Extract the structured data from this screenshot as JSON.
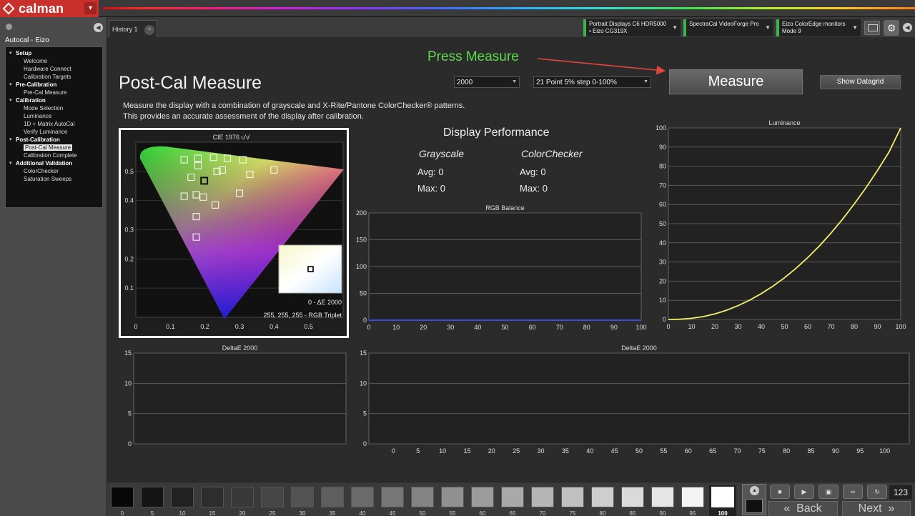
{
  "app": {
    "logo": "calman"
  },
  "colors": {
    "accent_red": "#c9302c",
    "green_status": "#3fb24a",
    "press_measure": "#5ddc4a",
    "curve_yellow": "#f4ee6a",
    "rgb_line": "#3a50ff"
  },
  "sidebar": {
    "title": "Autocal - Eizo",
    "sections": [
      {
        "label": "Setup",
        "items": [
          "Welcome",
          "Hardware Connect",
          "Calibration Targets"
        ]
      },
      {
        "label": "Pre-Calibration",
        "items": [
          "Pre-Cal Measure"
        ]
      },
      {
        "label": "Calibration",
        "items": [
          "Mode Selection",
          "Luminance",
          "1D + Matrix AutoCal",
          "Verify Luminance"
        ]
      },
      {
        "label": "Post-Calibration",
        "items": [
          "Post-Cal Measure",
          "Calibration Complete"
        ]
      },
      {
        "label": "Additional Validation",
        "items": [
          "ColorChecker",
          "Saturation Sweeps"
        ]
      }
    ],
    "active_item": "Post-Cal Measure"
  },
  "tabs": {
    "history": "History 1",
    "add": "+"
  },
  "devices": [
    {
      "line1": "Portrait Displays C6 HDR5000",
      "line2": "• Eizo CG319X"
    },
    {
      "line1": "SpectraCal VideoForge Pro",
      "line2": ""
    },
    {
      "line1": "Eizo ColorEdge monitors",
      "line2": "Mode 9"
    }
  ],
  "annotation": {
    "press_measure": "Press Measure"
  },
  "page": {
    "title": "Post-Cal Measure",
    "desc1": "Measure the display with a combination of grayscale and X-Rite/Pantone ColorChecker® patterns.",
    "desc2": "This provides an accurate assessment of the display after calibration."
  },
  "controls": {
    "de_select": "2000",
    "point_select": "21 Point 5% step 0-100%",
    "measure": "Measure",
    "show_datagrid": "Show Datagrid"
  },
  "performance": {
    "title": "Display Performance",
    "grayscale": {
      "label": "Grayscale",
      "avg": "Avg: 0",
      "max": "Max: 0"
    },
    "colorchecker": {
      "label": "ColorChecker",
      "avg": "Avg: 0",
      "max": "Max: 0"
    }
  },
  "cie": {
    "title": "CIE 1976 u'v'",
    "de_label": "0 - ΔE 2000",
    "triplet_label": "255, 255, 255 - RGB Triplet",
    "x_ticks": [
      "0",
      "0.1",
      "0.2",
      "0.3",
      "0.4",
      "0.5"
    ],
    "y_ticks": [
      "0.1",
      "0.2",
      "0.3",
      "0.4",
      "0.5"
    ]
  },
  "chart_data": [
    {
      "type": "line",
      "title": "Luminance",
      "xlabel": "",
      "ylabel": "",
      "xlim": [
        0,
        100
      ],
      "ylim": [
        0,
        100
      ],
      "x_ticks": [
        "0",
        "10",
        "20",
        "30",
        "40",
        "50",
        "60",
        "70",
        "80",
        "90",
        "100"
      ],
      "y_ticks": [
        "0",
        "10",
        "20",
        "30",
        "40",
        "50",
        "60",
        "70",
        "80",
        "90",
        "100"
      ],
      "x": [
        0,
        5,
        10,
        15,
        20,
        25,
        30,
        35,
        40,
        45,
        50,
        55,
        60,
        65,
        70,
        75,
        80,
        85,
        90,
        95,
        100
      ],
      "series": [
        {
          "values": [
            0,
            0.1,
            0.6,
            1.5,
            2.9,
            4.8,
            7.2,
            10.1,
            13.5,
            17.4,
            21.8,
            26.8,
            32.3,
            38.4,
            45.1,
            52.4,
            60.3,
            68.7,
            77.8,
            87.5,
            100
          ]
        }
      ],
      "grid": true
    },
    {
      "type": "line",
      "title": "RGB Balance",
      "xlabel": "",
      "ylabel": "",
      "xlim": [
        0,
        100
      ],
      "ylim": [
        0,
        200
      ],
      "x_ticks": [
        "0",
        "10",
        "20",
        "30",
        "40",
        "50",
        "60",
        "70",
        "80",
        "90",
        "100"
      ],
      "y_ticks": [
        "0",
        "50",
        "100",
        "150",
        "200"
      ],
      "x": [
        0,
        100
      ],
      "series": [
        {
          "values": [
            0,
            0
          ]
        }
      ],
      "grid": true
    },
    {
      "type": "bar",
      "title": "DeltaE 2000",
      "ylim": [
        0,
        15
      ],
      "y_ticks": [
        "0",
        "5",
        "10",
        "15"
      ],
      "categories": [],
      "values": [],
      "grid": true
    },
    {
      "type": "bar",
      "title": "DeltaE 2000",
      "ylim": [
        0,
        15
      ],
      "y_ticks": [
        "0",
        "5",
        "10",
        "15"
      ],
      "categories": [
        "0",
        "5",
        "10",
        "15",
        "20",
        "25",
        "30",
        "35",
        "40",
        "45",
        "50",
        "55",
        "60",
        "65",
        "70",
        "75",
        "80",
        "85",
        "90",
        "95",
        "100"
      ],
      "values": [],
      "grid": true
    }
  ],
  "swatches": [
    "0",
    "5",
    "10",
    "15",
    "20",
    "25",
    "30",
    "35",
    "40",
    "45",
    "50",
    "55",
    "60",
    "65",
    "70",
    "75",
    "80",
    "85",
    "90",
    "95",
    "100"
  ],
  "active_swatch": "100",
  "nav": {
    "back": "Back",
    "next": "Next",
    "counter": "123"
  }
}
